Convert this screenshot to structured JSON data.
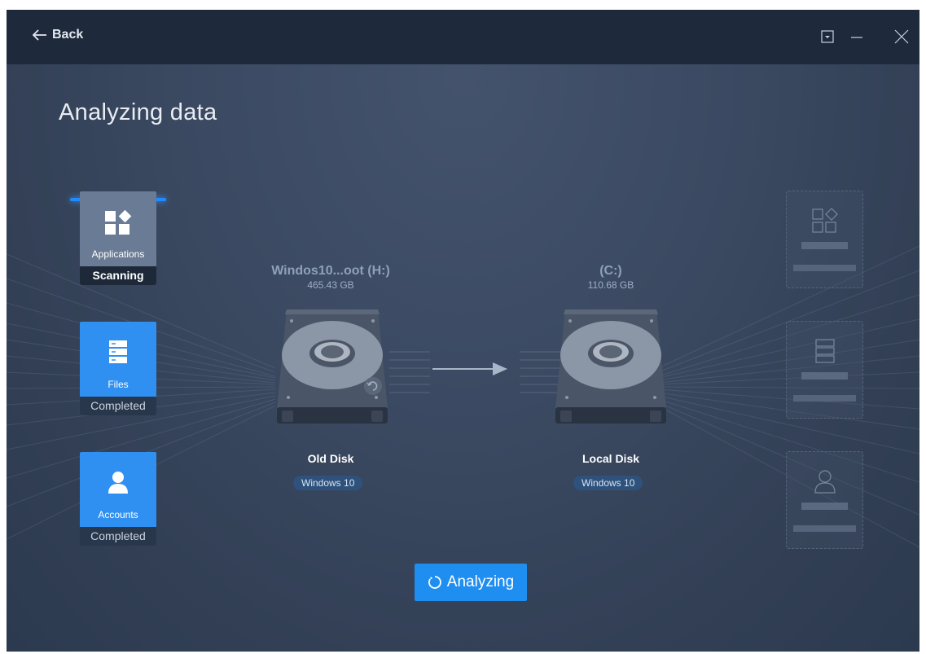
{
  "titlebar": {
    "back_label": "Back"
  },
  "page": {
    "title": "Analyzing data"
  },
  "categories": [
    {
      "label": "Applications",
      "status": "Scanning",
      "icon": "applications-icon"
    },
    {
      "label": "Files",
      "status": "Completed",
      "icon": "files-icon"
    },
    {
      "label": "Accounts",
      "status": "Completed",
      "icon": "accounts-icon"
    }
  ],
  "source_disk": {
    "name": "Windos10...oot (H:)",
    "size": "465.43 GB",
    "label": "Old Disk",
    "os": "Windows 10"
  },
  "target_disk": {
    "name": "(C:)",
    "size": "110.68 GB",
    "label": "Local Disk",
    "os": "Windows 10"
  },
  "action_button": {
    "label": "Analyzing",
    "icon": "spinner-icon"
  },
  "colors": {
    "accent": "#1f8ef1",
    "titlebar": "#1e2a3b",
    "background": "#3b4a62"
  }
}
